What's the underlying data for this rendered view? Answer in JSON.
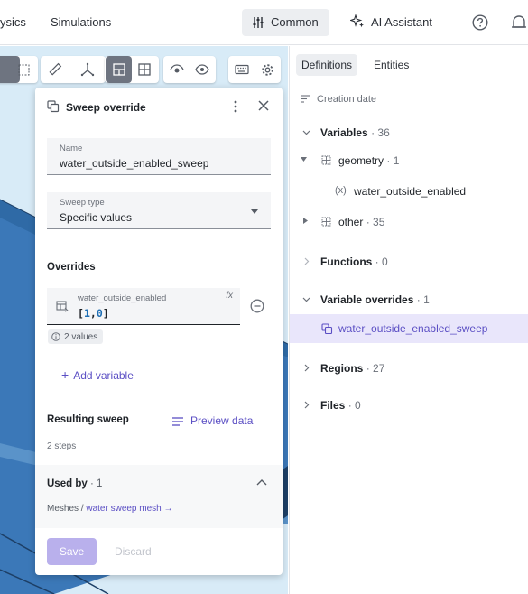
{
  "topbar": {
    "nav_physics": "ysics",
    "nav_simulations": "Simulations",
    "common_label": "Common",
    "ai_label": "AI Assistant"
  },
  "sweep_panel": {
    "title": "Sweep override",
    "name_label": "Name",
    "name_value": "water_outside_enabled_sweep",
    "sweep_type_label": "Sweep type",
    "sweep_type_value": "Specific values",
    "overrides_heading": "Overrides",
    "override_variable": "water_outside_enabled",
    "override_value_open": "[",
    "override_value_a": "1",
    "override_value_sep": ",",
    "override_value_b": "0",
    "override_value_close": "]",
    "fx_label": "fx",
    "values_chip": "2 values",
    "add_variable": "Add variable",
    "resulting_sweep": "Resulting sweep",
    "preview_data": "Preview data",
    "steps": "2 steps",
    "used_by": "Used by",
    "used_by_count": "· 1",
    "meshes_prefix": "Meshes /",
    "meshes_link": "water sweep mesh →",
    "save": "Save",
    "discard": "Discard"
  },
  "right_panel": {
    "tabs": [
      "Definitions",
      "Entities"
    ],
    "sort_label": "Creation date",
    "tree": {
      "variables": "Variables",
      "variables_count": "· 36",
      "geometry": "geometry",
      "geometry_count": "· 1",
      "water_outside_enabled": "water_outside_enabled",
      "other": "other",
      "other_count": "· 35",
      "functions": "Functions",
      "functions_count": "· 0",
      "variable_overrides": "Variable overrides",
      "variable_overrides_count": "· 1",
      "sweep_item": "water_outside_enabled_sweep",
      "regions": "Regions",
      "regions_count": "· 27",
      "files": "Files",
      "files_count": "· 0"
    }
  },
  "colors": {
    "accent": "#5b4fc4",
    "selected_bg": "#e9e6fb",
    "viewport_bg": "#d8ebf7",
    "mesh_blue": "#3b78b8"
  }
}
